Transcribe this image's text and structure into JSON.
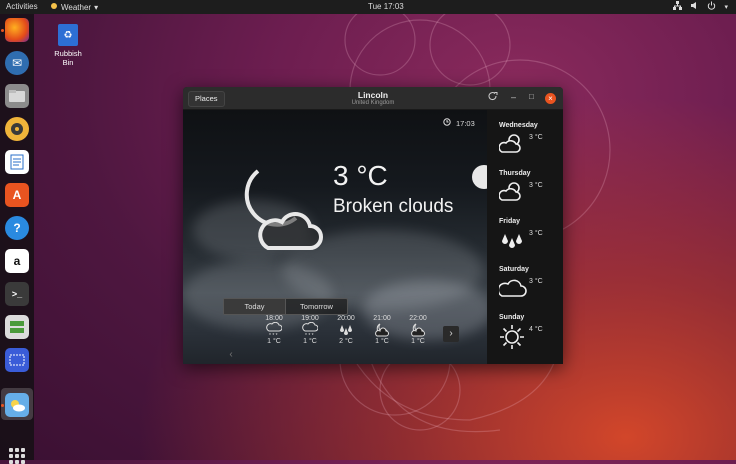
{
  "topbar": {
    "activities": "Activities",
    "app_menu": "Weather",
    "clock": "Tue 17:03"
  },
  "desktop": {
    "trash_label": "Rubbish Bin"
  },
  "dock": {
    "items": [
      "firefox",
      "thunderbird",
      "files",
      "rhythmbox",
      "libreoffice-writer",
      "ubuntu-software",
      "help",
      "amazon",
      "terminal",
      "system-monitor",
      "screenshot",
      "weather"
    ]
  },
  "window": {
    "places_button": "Places",
    "city": "Lincoln",
    "country": "United Kingdom",
    "updated_time": "17:03",
    "temperature": "3 °C",
    "condition": "Broken clouds",
    "tabs": [
      "Today",
      "Tomorrow"
    ],
    "hourly": [
      {
        "time": "18:00",
        "temp": "1 °C",
        "icon": "snow-icon"
      },
      {
        "time": "19:00",
        "temp": "1 °C",
        "icon": "snow-icon"
      },
      {
        "time": "20:00",
        "temp": "2 °C",
        "icon": "rain-icon"
      },
      {
        "time": "21:00",
        "temp": "1 °C",
        "icon": "cloudy-night-icon"
      },
      {
        "time": "22:00",
        "temp": "1 °C",
        "icon": "cloudy-night-icon"
      }
    ],
    "forecast": [
      {
        "day": "Wednesday",
        "temp": "3 °C",
        "icon": "partly-cloudy-icon"
      },
      {
        "day": "Thursday",
        "temp": "3 °C",
        "icon": "partly-cloudy-icon"
      },
      {
        "day": "Friday",
        "temp": "3 °C",
        "icon": "rain-icon"
      },
      {
        "day": "Saturday",
        "temp": "3 °C",
        "icon": "cloud-icon"
      },
      {
        "day": "Sunday",
        "temp": "4 °C",
        "icon": "sun-icon"
      }
    ]
  },
  "colors": {
    "accent": "#e95420",
    "topbar": "#1d1d1d"
  }
}
